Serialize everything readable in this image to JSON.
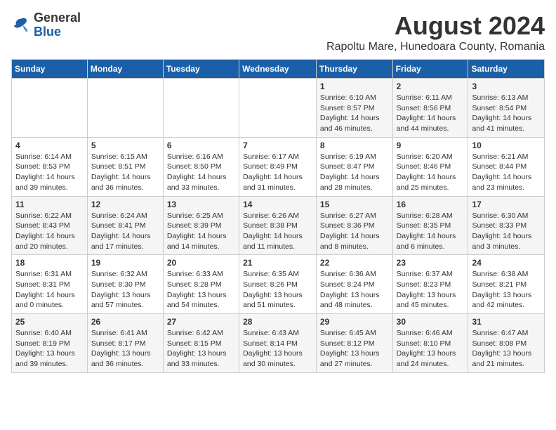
{
  "logo": {
    "general": "General",
    "blue": "Blue"
  },
  "title": {
    "month_year": "August 2024",
    "location": "Rapoltu Mare, Hunedoara County, Romania"
  },
  "days_of_week": [
    "Sunday",
    "Monday",
    "Tuesday",
    "Wednesday",
    "Thursday",
    "Friday",
    "Saturday"
  ],
  "weeks": [
    [
      {
        "day": "",
        "info": ""
      },
      {
        "day": "",
        "info": ""
      },
      {
        "day": "",
        "info": ""
      },
      {
        "day": "",
        "info": ""
      },
      {
        "day": "1",
        "info": "Sunrise: 6:10 AM\nSunset: 8:57 PM\nDaylight: 14 hours\nand 46 minutes."
      },
      {
        "day": "2",
        "info": "Sunrise: 6:11 AM\nSunset: 8:56 PM\nDaylight: 14 hours\nand 44 minutes."
      },
      {
        "day": "3",
        "info": "Sunrise: 6:13 AM\nSunset: 8:54 PM\nDaylight: 14 hours\nand 41 minutes."
      }
    ],
    [
      {
        "day": "4",
        "info": "Sunrise: 6:14 AM\nSunset: 8:53 PM\nDaylight: 14 hours\nand 39 minutes."
      },
      {
        "day": "5",
        "info": "Sunrise: 6:15 AM\nSunset: 8:51 PM\nDaylight: 14 hours\nand 36 minutes."
      },
      {
        "day": "6",
        "info": "Sunrise: 6:16 AM\nSunset: 8:50 PM\nDaylight: 14 hours\nand 33 minutes."
      },
      {
        "day": "7",
        "info": "Sunrise: 6:17 AM\nSunset: 8:49 PM\nDaylight: 14 hours\nand 31 minutes."
      },
      {
        "day": "8",
        "info": "Sunrise: 6:19 AM\nSunset: 8:47 PM\nDaylight: 14 hours\nand 28 minutes."
      },
      {
        "day": "9",
        "info": "Sunrise: 6:20 AM\nSunset: 8:46 PM\nDaylight: 14 hours\nand 25 minutes."
      },
      {
        "day": "10",
        "info": "Sunrise: 6:21 AM\nSunset: 8:44 PM\nDaylight: 14 hours\nand 23 minutes."
      }
    ],
    [
      {
        "day": "11",
        "info": "Sunrise: 6:22 AM\nSunset: 8:43 PM\nDaylight: 14 hours\nand 20 minutes."
      },
      {
        "day": "12",
        "info": "Sunrise: 6:24 AM\nSunset: 8:41 PM\nDaylight: 14 hours\nand 17 minutes."
      },
      {
        "day": "13",
        "info": "Sunrise: 6:25 AM\nSunset: 8:39 PM\nDaylight: 14 hours\nand 14 minutes."
      },
      {
        "day": "14",
        "info": "Sunrise: 6:26 AM\nSunset: 8:38 PM\nDaylight: 14 hours\nand 11 minutes."
      },
      {
        "day": "15",
        "info": "Sunrise: 6:27 AM\nSunset: 8:36 PM\nDaylight: 14 hours\nand 8 minutes."
      },
      {
        "day": "16",
        "info": "Sunrise: 6:28 AM\nSunset: 8:35 PM\nDaylight: 14 hours\nand 6 minutes."
      },
      {
        "day": "17",
        "info": "Sunrise: 6:30 AM\nSunset: 8:33 PM\nDaylight: 14 hours\nand 3 minutes."
      }
    ],
    [
      {
        "day": "18",
        "info": "Sunrise: 6:31 AM\nSunset: 8:31 PM\nDaylight: 14 hours\nand 0 minutes."
      },
      {
        "day": "19",
        "info": "Sunrise: 6:32 AM\nSunset: 8:30 PM\nDaylight: 13 hours\nand 57 minutes."
      },
      {
        "day": "20",
        "info": "Sunrise: 6:33 AM\nSunset: 8:28 PM\nDaylight: 13 hours\nand 54 minutes."
      },
      {
        "day": "21",
        "info": "Sunrise: 6:35 AM\nSunset: 8:26 PM\nDaylight: 13 hours\nand 51 minutes."
      },
      {
        "day": "22",
        "info": "Sunrise: 6:36 AM\nSunset: 8:24 PM\nDaylight: 13 hours\nand 48 minutes."
      },
      {
        "day": "23",
        "info": "Sunrise: 6:37 AM\nSunset: 8:23 PM\nDaylight: 13 hours\nand 45 minutes."
      },
      {
        "day": "24",
        "info": "Sunrise: 6:38 AM\nSunset: 8:21 PM\nDaylight: 13 hours\nand 42 minutes."
      }
    ],
    [
      {
        "day": "25",
        "info": "Sunrise: 6:40 AM\nSunset: 8:19 PM\nDaylight: 13 hours\nand 39 minutes."
      },
      {
        "day": "26",
        "info": "Sunrise: 6:41 AM\nSunset: 8:17 PM\nDaylight: 13 hours\nand 36 minutes."
      },
      {
        "day": "27",
        "info": "Sunrise: 6:42 AM\nSunset: 8:15 PM\nDaylight: 13 hours\nand 33 minutes."
      },
      {
        "day": "28",
        "info": "Sunrise: 6:43 AM\nSunset: 8:14 PM\nDaylight: 13 hours\nand 30 minutes."
      },
      {
        "day": "29",
        "info": "Sunrise: 6:45 AM\nSunset: 8:12 PM\nDaylight: 13 hours\nand 27 minutes."
      },
      {
        "day": "30",
        "info": "Sunrise: 6:46 AM\nSunset: 8:10 PM\nDaylight: 13 hours\nand 24 minutes."
      },
      {
        "day": "31",
        "info": "Sunrise: 6:47 AM\nSunset: 8:08 PM\nDaylight: 13 hours\nand 21 minutes."
      }
    ]
  ]
}
